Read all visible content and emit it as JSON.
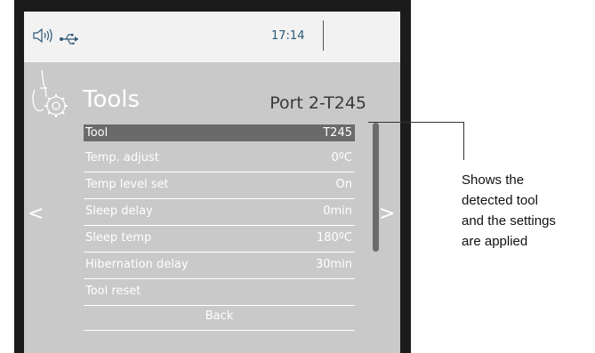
{
  "status_bar": {
    "time": "17:14",
    "icons": [
      "speaker-icon",
      "usb-icon"
    ]
  },
  "page": {
    "title": "Tools",
    "port": "Port 2-T245"
  },
  "menu": {
    "items": [
      {
        "label": "Tool",
        "value": "T245",
        "selected": true
      },
      {
        "label": "Temp. adjust",
        "value": "0ºC"
      },
      {
        "label": "Temp level set",
        "value": "On"
      },
      {
        "label": "Sleep delay",
        "value": "0min"
      },
      {
        "label": "Sleep temp",
        "value": "180ºC"
      },
      {
        "label": "Hibernation delay",
        "value": "30min"
      },
      {
        "label": "Tool reset",
        "value": ""
      }
    ],
    "back_label": "Back"
  },
  "nav": {
    "left": "<",
    "right": ">"
  },
  "callout": {
    "lines": [
      "Shows the",
      "detected tool",
      "and the settings",
      "are applied"
    ]
  },
  "colors": {
    "screen_bg": "#c9c9c9",
    "status_bg": "#f2f2f2",
    "selected_row": "#6a6a6a",
    "time_text": "#2c5a78",
    "bezel": "#1b1b1b"
  }
}
